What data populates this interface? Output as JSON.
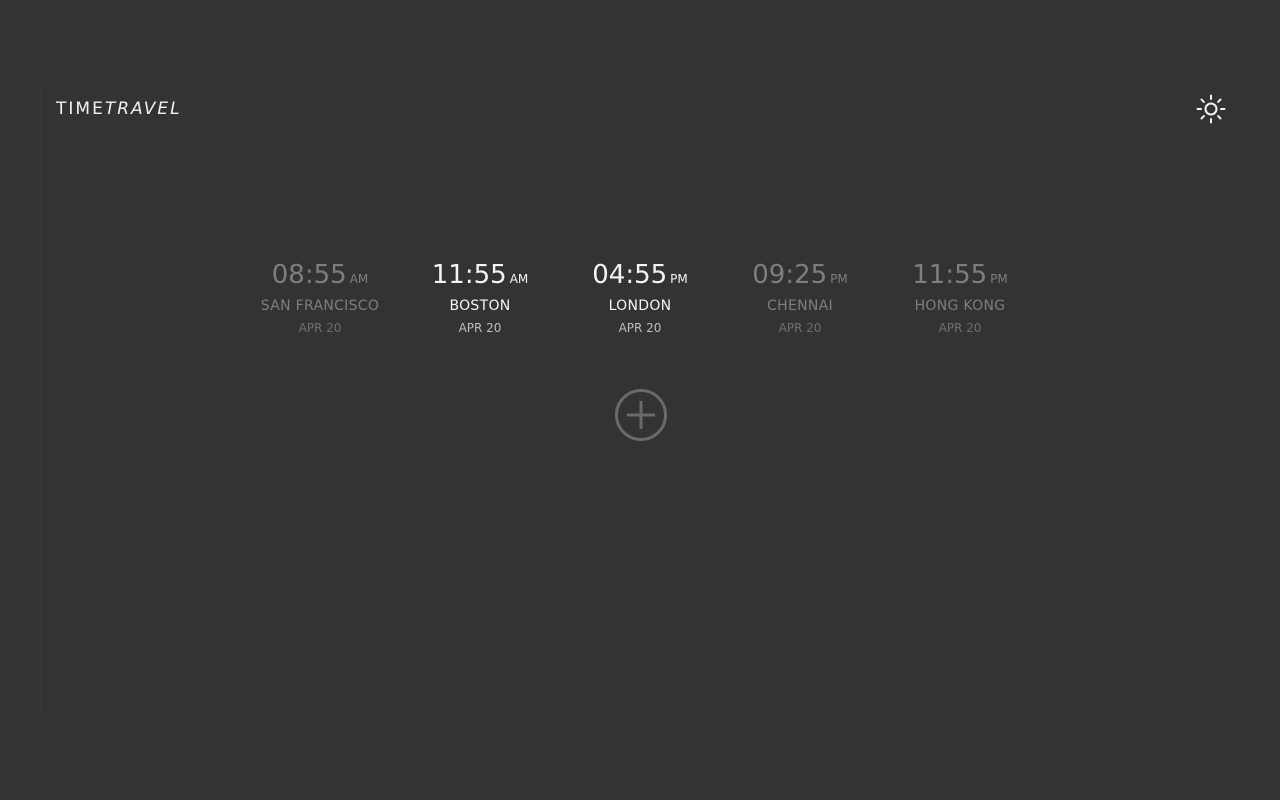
{
  "header": {
    "logo_part1": "TIME",
    "logo_part2": "TRAVEL",
    "theme_icon": "sun-icon"
  },
  "clocks": [
    {
      "time": "08:55",
      "ampm": "AM",
      "city": "SAN FRANCISCO",
      "date": "APR 20",
      "active": false
    },
    {
      "time": "11:55",
      "ampm": "AM",
      "city": "BOSTON",
      "date": "APR 20",
      "active": true
    },
    {
      "time": "04:55",
      "ampm": "PM",
      "city": "LONDON",
      "date": "APR 20",
      "active": true
    },
    {
      "time": "09:25",
      "ampm": "PM",
      "city": "CHENNAI",
      "date": "APR 20",
      "active": false
    },
    {
      "time": "11:55",
      "ampm": "PM",
      "city": "HONG KONG",
      "date": "APR 20",
      "active": false
    }
  ],
  "add_button": {
    "icon": "plus-circle-icon"
  },
  "colors": {
    "background": "#333333",
    "active_text": "#f4f4f4",
    "inactive_text": "#7e7e7e",
    "add_button": "#6a6a6a"
  }
}
